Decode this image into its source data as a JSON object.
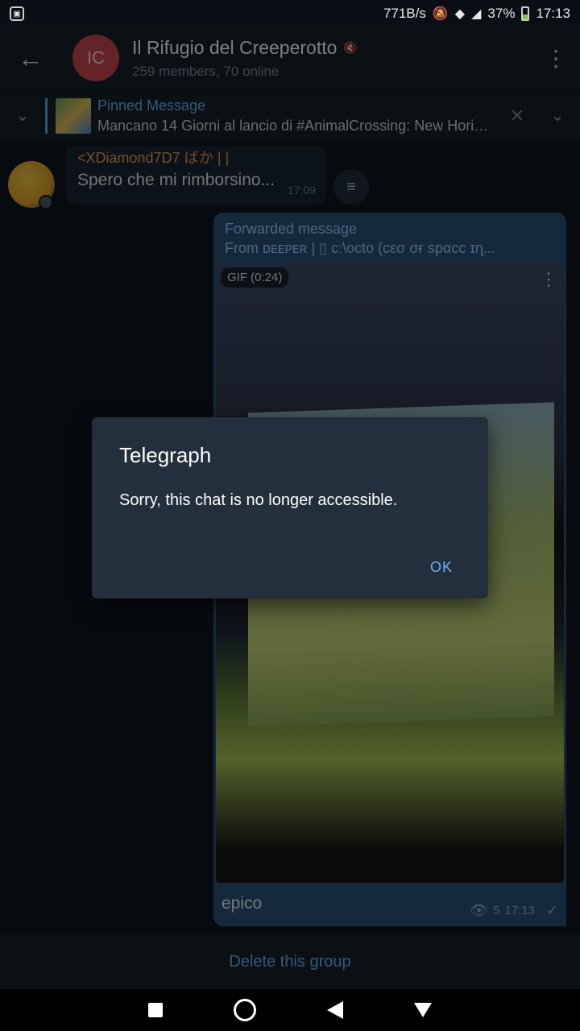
{
  "status_bar": {
    "network_speed": "771B/s",
    "battery": "37%",
    "time": "17:13"
  },
  "header": {
    "avatar_initials": "IC",
    "title": "Il Rifugio del Creeperotto",
    "subtitle": "259 members, 70 online"
  },
  "pinned": {
    "title": "Pinned Message",
    "text": "Mancano 14 Giorni al lancio di #AnimalCrossing: New Hori…"
  },
  "messages": [
    {
      "sender": "<XDiamond7D7 ばか | |",
      "text": "Spero che mi rimborsino...",
      "time": "17:09"
    }
  ],
  "forwarded": {
    "header": "Forwarded message",
    "from": "From  ᴅᴇᴇᴘᴇʀ | ▯ c:\\octo (cεσ σғ spαcc ɪɳ...",
    "gif_badge": "GIF (0:24)",
    "caption": "epico",
    "views": "5",
    "time": "17:13"
  },
  "bottom": {
    "delete_label": "Delete this group"
  },
  "dialog": {
    "title": "Telegraph",
    "text": "Sorry, this chat is no longer accessible.",
    "ok": "OK"
  },
  "colors": {
    "accent": "#6ab2f2",
    "bg": "#0e1621",
    "header": "#17212b",
    "bubble_out": "#2b5278",
    "sender": "#e99a54",
    "dialog": "#232f3d"
  }
}
